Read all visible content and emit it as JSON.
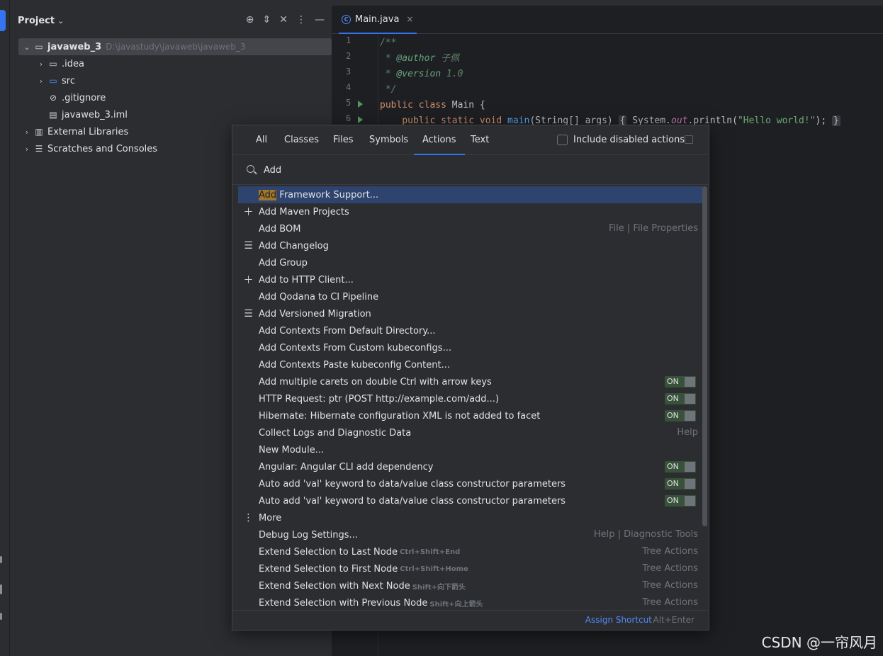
{
  "project_panel": {
    "title": "Project",
    "title_chevron": "⌄",
    "tools": [
      "⊕",
      "⇕",
      "✕",
      "⋮",
      "—"
    ],
    "tree": [
      {
        "chevron": "⌄",
        "icon": "folder-module-icon",
        "label": "javaweb_3",
        "path": "D:\\javastudy\\javaweb\\javaweb_3",
        "indent": 0,
        "selected": true,
        "bold": true
      },
      {
        "chevron": "›",
        "icon": "folder-icon",
        "label": ".idea",
        "path": "",
        "indent": 1
      },
      {
        "chevron": "›",
        "icon": "source-folder-icon",
        "label": "src",
        "path": "",
        "indent": 1
      },
      {
        "chevron": "",
        "icon": "ignore-file-icon",
        "label": ".gitignore",
        "path": "",
        "indent": 1
      },
      {
        "chevron": "",
        "icon": "module-file-icon",
        "label": "javaweb_3.iml",
        "path": "",
        "indent": 1
      },
      {
        "chevron": "›",
        "icon": "library-icon",
        "label": "External Libraries",
        "path": "",
        "indent": 0
      },
      {
        "chevron": "›",
        "icon": "scratches-icon",
        "label": "Scratches and Consoles",
        "path": "",
        "indent": 0
      }
    ]
  },
  "editor": {
    "tab_label": "Main.java",
    "tab_icon_letter": "C",
    "tab_close": "×",
    "line_numbers": [
      "1",
      "2",
      "3",
      "4",
      "5",
      "6"
    ],
    "code": {
      "l1": "/**",
      "l2_prefix": " * ",
      "l2_tag": "@author",
      "l2_val": " 子佩",
      "l3_prefix": " * ",
      "l3_tag": "@version",
      "l3_val": " 1.0",
      "l4": " */",
      "l5_kw": "public class",
      "l5_rest": " Main {",
      "l6_kw": "    public static void",
      "l6_fn": " main",
      "l6_args": "(String[] args) ",
      "l6_open": "{",
      "l6_sys": " System.",
      "l6_out": "out",
      "l6_call": ".println(",
      "l6_str": "\"Hello world!\"",
      "l6_end": "); ",
      "l6_close": "}"
    }
  },
  "search_popup": {
    "tabs": [
      "All",
      "Classes",
      "Files",
      "Symbols",
      "Actions",
      "Text"
    ],
    "active_tab": "Actions",
    "include_disabled_label": "Include disabled actions",
    "query": "Add",
    "results": [
      {
        "icon": "",
        "highlight": "Add",
        "label": " Framework Support...",
        "shortcut": "",
        "right": "",
        "toggle": "",
        "selected": true
      },
      {
        "icon": "＋",
        "highlight": "",
        "label": "Add Maven Projects",
        "shortcut": "",
        "right": "",
        "toggle": ""
      },
      {
        "icon": "",
        "highlight": "",
        "label": "Add BOM",
        "shortcut": "",
        "right": "File | File Properties",
        "toggle": ""
      },
      {
        "icon": "☰",
        "highlight": "",
        "label": "Add Changelog",
        "shortcut": "",
        "right": "",
        "toggle": ""
      },
      {
        "icon": "",
        "highlight": "",
        "label": "Add Group",
        "shortcut": "",
        "right": "",
        "toggle": ""
      },
      {
        "icon": "＋",
        "highlight": "",
        "label": "Add to HTTP Client...",
        "shortcut": "",
        "right": "",
        "toggle": ""
      },
      {
        "icon": "",
        "highlight": "",
        "label": "Add Qodana to CI Pipeline",
        "shortcut": "",
        "right": "",
        "toggle": ""
      },
      {
        "icon": "☰",
        "highlight": "",
        "label": "Add Versioned Migration",
        "shortcut": "",
        "right": "",
        "toggle": ""
      },
      {
        "icon": "",
        "highlight": "",
        "label": "Add Contexts From Default Directory...",
        "shortcut": "",
        "right": "",
        "toggle": ""
      },
      {
        "icon": "",
        "highlight": "",
        "label": "Add Contexts From Custom kubeconfigs...",
        "shortcut": "",
        "right": "",
        "toggle": ""
      },
      {
        "icon": "",
        "highlight": "",
        "label": "Add Contexts Paste kubeconfig Content...",
        "shortcut": "",
        "right": "",
        "toggle": ""
      },
      {
        "icon": "",
        "highlight": "",
        "label": "Add multiple carets on double Ctrl with arrow keys",
        "shortcut": "",
        "right": "",
        "toggle": "ON"
      },
      {
        "icon": "",
        "highlight": "",
        "label": "HTTP Request: ptr (POST http://example.com/add...)",
        "shortcut": "",
        "right": "",
        "toggle": "ON"
      },
      {
        "icon": "",
        "highlight": "",
        "label": "Hibernate: Hibernate configuration XML is not added to facet",
        "shortcut": "",
        "right": "",
        "toggle": "ON"
      },
      {
        "icon": "",
        "highlight": "",
        "label": "Collect Logs and Diagnostic Data",
        "shortcut": "",
        "right": "Help",
        "toggle": ""
      },
      {
        "icon": "",
        "highlight": "",
        "label": "New Module...",
        "shortcut": "",
        "right": "",
        "toggle": ""
      },
      {
        "icon": "",
        "highlight": "",
        "label": "Angular: Angular CLI add dependency",
        "shortcut": "",
        "right": "",
        "toggle": "ON"
      },
      {
        "icon": "",
        "highlight": "",
        "label": "Auto add 'val' keyword to data/value class constructor parameters",
        "shortcut": "",
        "right": "",
        "toggle": "ON"
      },
      {
        "icon": "",
        "highlight": "",
        "label": "Auto add 'val' keyword to data/value class constructor parameters",
        "shortcut": "",
        "right": "",
        "toggle": "ON"
      },
      {
        "icon": "⋮",
        "highlight": "",
        "label": "More",
        "shortcut": "",
        "right": "",
        "toggle": ""
      },
      {
        "icon": "",
        "highlight": "",
        "label": "Debug Log Settings...",
        "shortcut": "",
        "right": "Help | Diagnostic Tools",
        "toggle": ""
      },
      {
        "icon": "",
        "highlight": "",
        "label": "Extend Selection to Last Node",
        "shortcut": "Ctrl+Shift+End",
        "right": "Tree Actions",
        "toggle": ""
      },
      {
        "icon": "",
        "highlight": "",
        "label": "Extend Selection to First Node",
        "shortcut": "Ctrl+Shift+Home",
        "right": "Tree Actions",
        "toggle": ""
      },
      {
        "icon": "",
        "highlight": "",
        "label": "Extend Selection with Next Node",
        "shortcut": "Shift+向下箭头",
        "right": "Tree Actions",
        "toggle": ""
      },
      {
        "icon": "",
        "highlight": "",
        "label": "Extend Selection with Previous Node",
        "shortcut": "Shift+向上箭头",
        "right": "Tree Actions",
        "toggle": ""
      }
    ],
    "footer": {
      "assign_label": "Assign Shortcut",
      "assign_key": "Alt+Enter"
    }
  },
  "watermark": "CSDN @一帘风月"
}
